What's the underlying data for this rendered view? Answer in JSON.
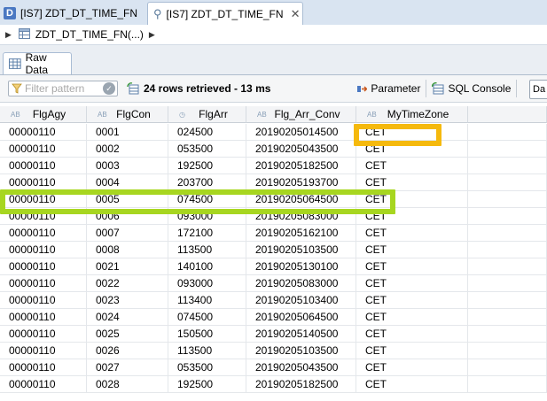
{
  "editor_tabs": [
    {
      "label": "[IS7] ZDT_DT_TIME_FN",
      "icon": "database-d-icon",
      "active": false
    },
    {
      "label": "[IS7] ZDT_DT_TIME_FN",
      "icon": "pin-icon",
      "active": true,
      "close": "✕"
    }
  ],
  "breadcrumb": {
    "label": "ZDT_DT_TIME_FN(...)"
  },
  "subtab": {
    "label": "Raw Data"
  },
  "toolbar": {
    "filter_placeholder": "Filter pattern",
    "rows_info": "24 rows retrieved - 13 ms",
    "parameter_label": "Parameter",
    "sql_console_label": "SQL Console",
    "truncated_button": "Da"
  },
  "table": {
    "columns": [
      "FlgAgy",
      "FlgCon",
      "FlgArr",
      "Flg_Arr_Conv",
      "MyTimeZone"
    ],
    "rows": [
      [
        "00000110",
        "0001",
        "024500",
        "20190205014500",
        "CET"
      ],
      [
        "00000110",
        "0002",
        "053500",
        "20190205043500",
        "CET"
      ],
      [
        "00000110",
        "0003",
        "192500",
        "20190205182500",
        "CET"
      ],
      [
        "00000110",
        "0004",
        "203700",
        "20190205193700",
        "CET"
      ],
      [
        "00000110",
        "0005",
        "074500",
        "20190205064500",
        "CET"
      ],
      [
        "00000110",
        "0006",
        "093000",
        "20190205083000",
        "CET"
      ],
      [
        "00000110",
        "0007",
        "172100",
        "20190205162100",
        "CET"
      ],
      [
        "00000110",
        "0008",
        "113500",
        "20190205103500",
        "CET"
      ],
      [
        "00000110",
        "0021",
        "140100",
        "20190205130100",
        "CET"
      ],
      [
        "00000110",
        "0022",
        "093000",
        "20190205083000",
        "CET"
      ],
      [
        "00000110",
        "0023",
        "113400",
        "20190205103400",
        "CET"
      ],
      [
        "00000110",
        "0024",
        "074500",
        "20190205064500",
        "CET"
      ],
      [
        "00000110",
        "0025",
        "150500",
        "20190205140500",
        "CET"
      ],
      [
        "00000110",
        "0026",
        "113500",
        "20190205103500",
        "CET"
      ],
      [
        "00000110",
        "0027",
        "053500",
        "20190205043500",
        "CET"
      ],
      [
        "00000110",
        "0028",
        "192500",
        "20190205182500",
        "CET"
      ]
    ]
  },
  "colors": {
    "highlight_cell": "#f5b90d",
    "highlight_row": "#a7d620"
  }
}
